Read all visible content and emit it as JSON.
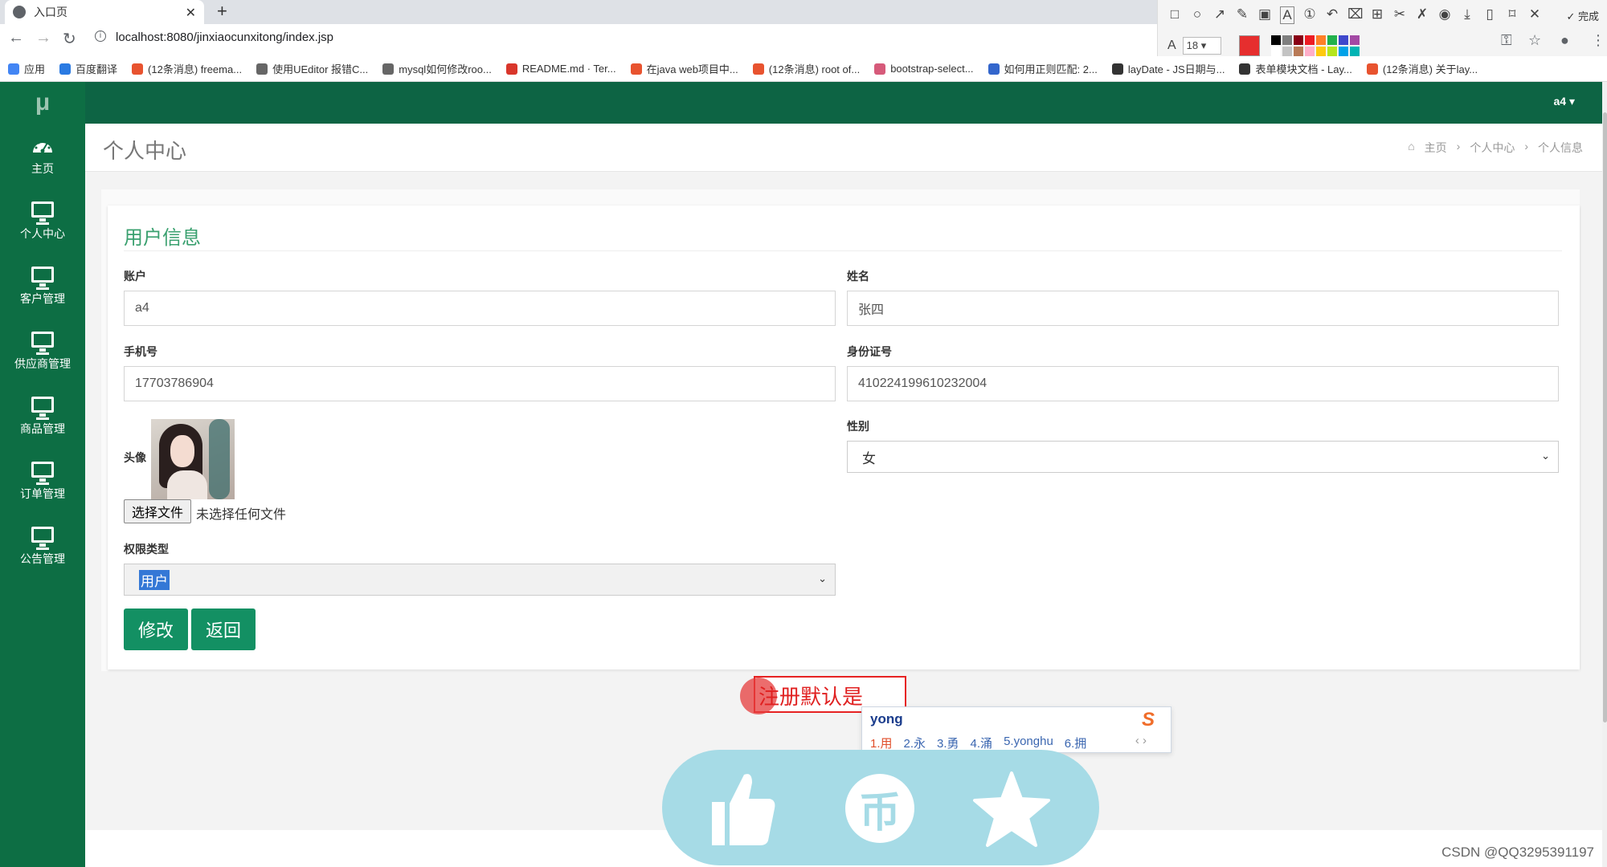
{
  "browser": {
    "tab_title": "入口页",
    "url": "localhost:8080/jinxiaocunxitong/index.jsp",
    "bookmarks": [
      {
        "label": "应用",
        "color": "#4285f4"
      },
      {
        "label": "百度翻译",
        "color": "#2a7ae2"
      },
      {
        "label": "(12条消息) freema...",
        "color": "#e8532f"
      },
      {
        "label": "使用UEditor 报错C...",
        "color": "#666666"
      },
      {
        "label": "mysql如何修改roo...",
        "color": "#666666"
      },
      {
        "label": "README.md · Ter...",
        "color": "#d9362b"
      },
      {
        "label": "在java web项目中...",
        "color": "#e8532f"
      },
      {
        "label": "(12条消息) root of...",
        "color": "#e8532f"
      },
      {
        "label": "bootstrap-select...",
        "color": "#d65a7a"
      },
      {
        "label": "如何用正则匹配: 2...",
        "color": "#3366cc"
      },
      {
        "label": "layDate - JS日期与...",
        "color": "#333333"
      },
      {
        "label": "表单模块文档 - Lay...",
        "color": "#333333"
      },
      {
        "label": "(12条消息) 关于lay...",
        "color": "#e8532f"
      }
    ]
  },
  "annotation_toolbar": {
    "font_size": "18",
    "done_label": "完成",
    "current_color": "#e62e2e",
    "palette": [
      "#000000",
      "#7f7f7f",
      "#880015",
      "#ed1c24",
      "#ff7f27",
      "#22b14c",
      "#3f48cc",
      "#a349a4",
      "#ffffff",
      "#c3c3c3",
      "#b97a57",
      "#ffaec9",
      "#ffc90e",
      "#b5e61d",
      "#00a2e8",
      "#00b4b4"
    ]
  },
  "app": {
    "logo": "μ",
    "user": "a4 ▾",
    "sidebar": [
      {
        "label": "主页",
        "icon": "dashboard-icon"
      },
      {
        "label": "个人中心",
        "icon": "monitor-icon"
      },
      {
        "label": "客户管理",
        "icon": "monitor-icon"
      },
      {
        "label": "供应商管理",
        "icon": "monitor-icon"
      },
      {
        "label": "商品管理",
        "icon": "monitor-icon"
      },
      {
        "label": "订单管理",
        "icon": "monitor-icon"
      },
      {
        "label": "公告管理",
        "icon": "monitor-icon"
      }
    ],
    "page_title": "个人中心",
    "breadcrumb": [
      "主页",
      "个人中心",
      "个人信息"
    ],
    "breadcrumb_sep": "›"
  },
  "form": {
    "title": "用户信息",
    "account_label": "账户",
    "account_value": "a4",
    "name_label": "姓名",
    "name_value": "张四",
    "phone_label": "手机号",
    "phone_value": "17703786904",
    "id_label": "身份证号",
    "id_value": "410224199610232004",
    "avatar_label": "头像",
    "file_button": "选择文件",
    "file_status": "未选择任何文件",
    "gender_label": "性别",
    "gender_value": "女",
    "role_label": "权限类型",
    "role_value": "用户",
    "submit_label": "修改",
    "back_label": "返回"
  },
  "overlay": {
    "annotation_text": "注册默认是",
    "ime_input": "yong",
    "ime_candidates": [
      "1.用",
      "2.永",
      "3.勇",
      "4.涌",
      "5.yonghu",
      "6.拥"
    ],
    "coin_glyph": "币"
  },
  "watermark": "CSDN @QQ3295391197"
}
